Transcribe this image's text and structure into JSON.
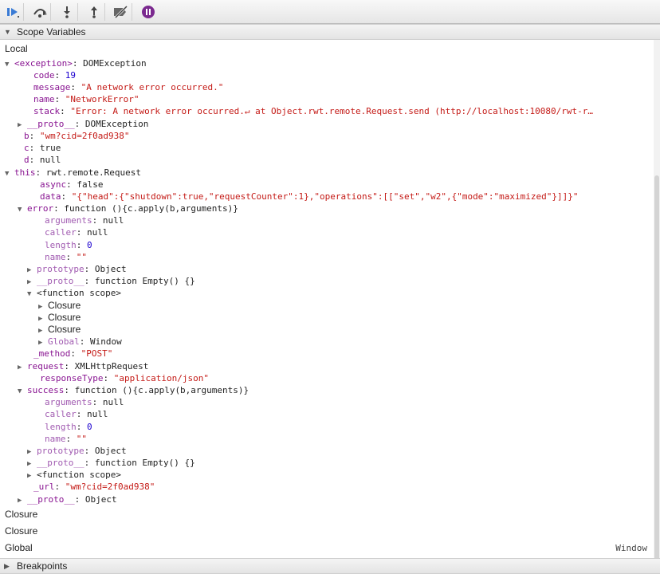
{
  "toolbar": {
    "buttons": [
      {
        "icon": "resume-icon"
      },
      {
        "icon": "step-over-icon"
      },
      {
        "icon": "step-into-icon"
      },
      {
        "icon": "step-out-icon"
      },
      {
        "icon": "deactivate-breakpoints-icon"
      },
      {
        "icon": "pause-on-exceptions-icon"
      }
    ],
    "accent": "#7b2a8f"
  },
  "scope": {
    "header": "Scope Variables",
    "bottom_header": "Breakpoints",
    "rows": [
      {
        "key": "Local"
      },
      {
        "key": "<exception>",
        "sep": ": ",
        "value": "DOMException"
      },
      {
        "key": "code",
        "sep": ": ",
        "value": "19"
      },
      {
        "key": "message",
        "sep": ": ",
        "value": "\"A network error occurred.\""
      },
      {
        "key": "name",
        "sep": ": ",
        "value": "\"NetworkError\""
      },
      {
        "key": "stack",
        "sep": ": ",
        "value": "\"Error: A network error occurred.↵    at Object.rwt.remote.Request.send (http://localhost:10080/rwt-r…"
      },
      {
        "key": "__proto__",
        "sep": ": ",
        "value": "DOMException"
      },
      {
        "key": "b",
        "sep": ": ",
        "value": "\"wm?cid=2f0ad938\""
      },
      {
        "key": "c",
        "sep": ": ",
        "value": "true"
      },
      {
        "key": "d",
        "sep": ": ",
        "value": "null"
      },
      {
        "key": "this",
        "sep": ": ",
        "value": "rwt.remote.Request"
      },
      {
        "key": "async",
        "sep": ": ",
        "value": "false"
      },
      {
        "key": "data",
        "sep": ": ",
        "value": "\"{\"head\":{\"shutdown\":true,\"requestCounter\":1},\"operations\":[[\"set\",\"w2\",{\"mode\":\"maximized\"}]]}\""
      },
      {
        "key": "error",
        "sep": ": ",
        "value": "function (){c.apply(b,arguments)}"
      },
      {
        "key": "arguments",
        "sep": ": ",
        "value": "null"
      },
      {
        "key": "caller",
        "sep": ": ",
        "value": "null"
      },
      {
        "key": "length",
        "sep": ": ",
        "value": "0"
      },
      {
        "key": "name",
        "sep": ": ",
        "value": "\"\""
      },
      {
        "key": "prototype",
        "sep": ": ",
        "value": "Object"
      },
      {
        "key": "__proto__",
        "sep": ": ",
        "value": "function Empty() {}"
      },
      {
        "key": "<function scope>"
      },
      {
        "key": "Closure"
      },
      {
        "key": "Closure"
      },
      {
        "key": "Closure"
      },
      {
        "key": "Global",
        "sep": ": ",
        "value": "Window"
      },
      {
        "key": "_method",
        "sep": ": ",
        "value": "\"POST\""
      },
      {
        "key": "request",
        "sep": ": ",
        "value": "XMLHttpRequest"
      },
      {
        "key": "responseType",
        "sep": ": ",
        "value": "\"application/json\""
      },
      {
        "key": "success",
        "sep": ": ",
        "value": "function (){c.apply(b,arguments)}"
      },
      {
        "key": "arguments",
        "sep": ": ",
        "value": "null"
      },
      {
        "key": "caller",
        "sep": ": ",
        "value": "null"
      },
      {
        "key": "length",
        "sep": ": ",
        "value": "0"
      },
      {
        "key": "name",
        "sep": ": ",
        "value": "\"\""
      },
      {
        "key": "prototype",
        "sep": ": ",
        "value": "Object"
      },
      {
        "key": "__proto__",
        "sep": ": ",
        "value": "function Empty() {}"
      },
      {
        "key": "<function scope>"
      },
      {
        "key": "_url",
        "sep": ": ",
        "value": "\"wm?cid=2f0ad938\""
      },
      {
        "key": "__proto__",
        "sep": ": ",
        "value": "Object"
      },
      {
        "key": "Closure"
      },
      {
        "key": "Closure"
      },
      {
        "key": "Global",
        "value_right": "Window"
      }
    ]
  }
}
